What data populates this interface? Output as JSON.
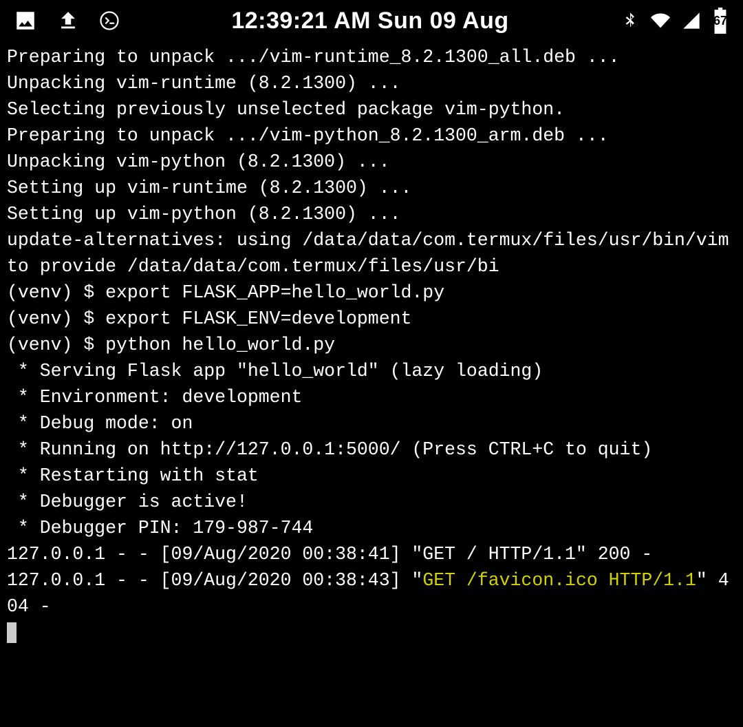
{
  "statusbar": {
    "clock": "12:39:21 AM Sun 09 Aug",
    "battery_pct": "67"
  },
  "terminal": {
    "segments": [
      {
        "t": "Preparing to unpack .../vim-runtime_8.2.1300_all.deb ...\n",
        "c": "w"
      },
      {
        "t": "Unpacking vim-runtime (8.2.1300) ...\n",
        "c": "w"
      },
      {
        "t": "Selecting previously unselected package vim-python.\n",
        "c": "w"
      },
      {
        "t": "Preparing to unpack .../vim-python_8.2.1300_arm.deb ...\n",
        "c": "w"
      },
      {
        "t": "Unpacking vim-python (8.2.1300) ...\n",
        "c": "w"
      },
      {
        "t": "Setting up vim-runtime (8.2.1300) ...\n",
        "c": "w"
      },
      {
        "t": "Setting up vim-python (8.2.1300) ...\n",
        "c": "w"
      },
      {
        "t": "update-alternatives: using /data/data/com.termux/files/usr/bin/vim to provide /data/data/com.termux/files/usr/bi\n",
        "c": "w"
      },
      {
        "t": "(venv) $ export FLASK_APP=hello_world.py\n",
        "c": "w"
      },
      {
        "t": "(venv) $ export FLASK_ENV=development\n",
        "c": "w"
      },
      {
        "t": "(venv) $ python hello_world.py\n",
        "c": "w"
      },
      {
        "t": " * Serving Flask app \"hello_world\" (lazy loading)\n",
        "c": "w"
      },
      {
        "t": " * Environment: development\n",
        "c": "w"
      },
      {
        "t": " * Debug mode: on\n",
        "c": "w"
      },
      {
        "t": " * Running on http://127.0.0.1:5000/ (Press CTRL+C to quit)\n",
        "c": "w"
      },
      {
        "t": " * Restarting with stat\n",
        "c": "w"
      },
      {
        "t": " * Debugger is active!\n",
        "c": "w"
      },
      {
        "t": " * Debugger PIN: 179-987-744\n",
        "c": "w"
      },
      {
        "t": "127.0.0.1 - - [09/Aug/2020 00:38:41] \"GET / HTTP/1.1\" 200 -\n",
        "c": "w"
      },
      {
        "t": "127.0.0.1 - - [09/Aug/2020 00:38:43] \"",
        "c": "w"
      },
      {
        "t": "GET /favicon.ico HTTP/1.1",
        "c": "y"
      },
      {
        "t": "\" 404 -\n",
        "c": "w"
      }
    ]
  }
}
